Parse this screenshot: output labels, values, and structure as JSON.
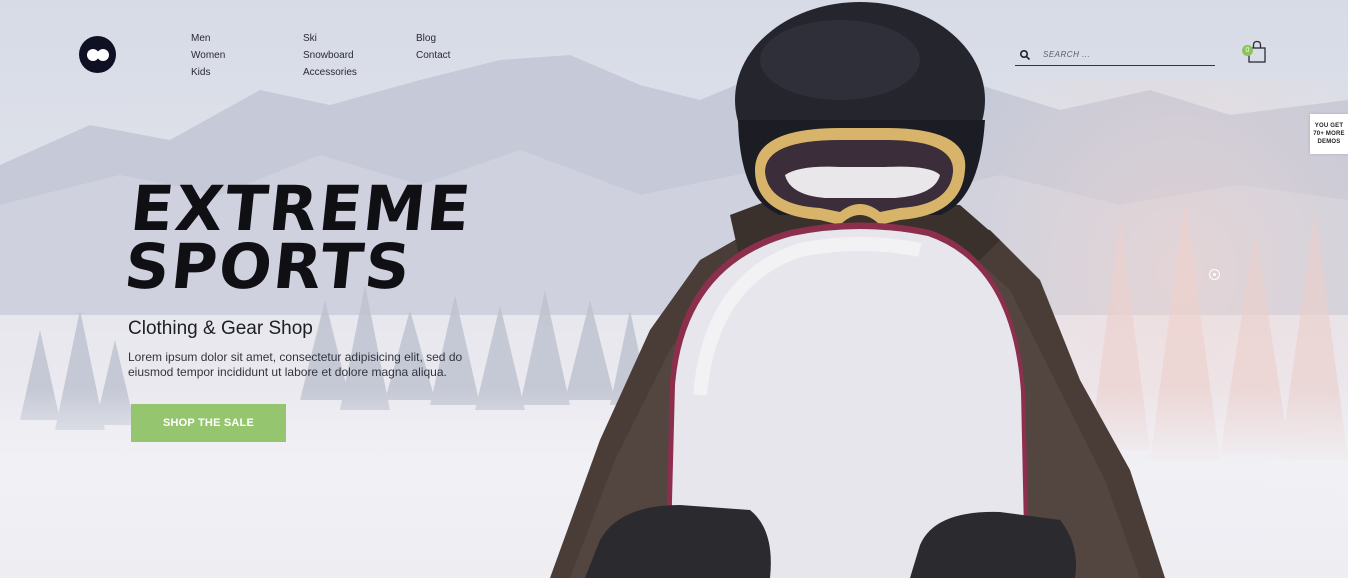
{
  "header": {
    "nav_columns": [
      [
        "Men",
        "Women",
        "Kids"
      ],
      [
        "Ski",
        "Snowboard",
        "Accessories"
      ],
      [
        "Blog",
        "Contact"
      ]
    ],
    "search": {
      "placeholder": "SEARCH ..."
    },
    "cart": {
      "count": "0"
    }
  },
  "hero": {
    "headline": "EXTREME\nSPORTS",
    "subheadline": "Clothing & Gear Shop",
    "description": "Lorem ipsum dolor sit amet, consectetur adipisicing elit, sed do eiusmod tempor incididunt ut labore et dolore magna aliqua.",
    "cta_label": "SHOP THE SALE"
  },
  "side_tab": {
    "label": "YOU GET 70+ MORE DEMOS"
  },
  "colors": {
    "accent_green": "#95c66f",
    "badge_green": "#8bc45b",
    "logo_dark": "#0f1024",
    "headline": "#101014"
  },
  "icons": [
    "logo-icon",
    "search-icon",
    "shopping-bag-icon",
    "scroll-indicator-icon"
  ]
}
